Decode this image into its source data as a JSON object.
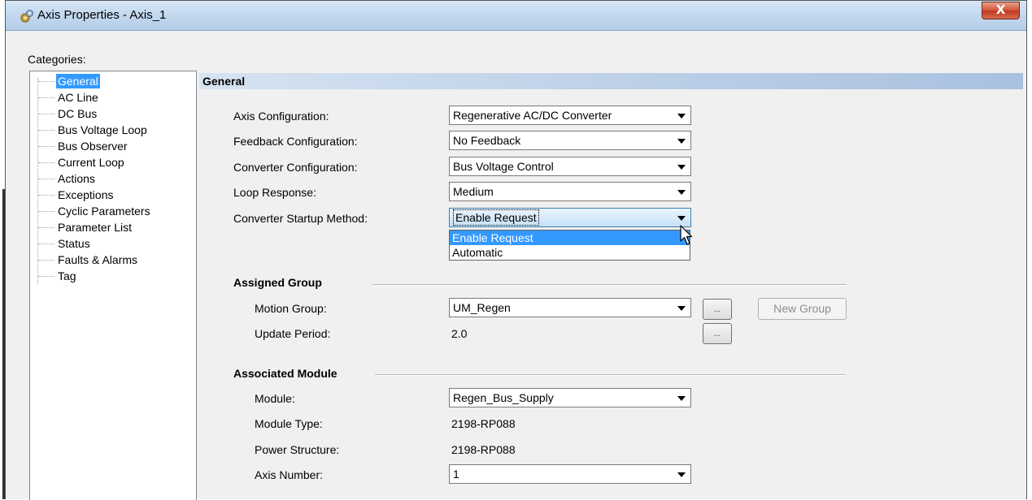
{
  "window": {
    "title": "Axis Properties - Axis_1",
    "close_label": "X"
  },
  "categories": {
    "label": "Categories:",
    "items": [
      "General",
      "AC Line",
      "DC Bus",
      "Bus Voltage Loop",
      "Bus Observer",
      "Current Loop",
      "Actions",
      "Exceptions",
      "Cyclic Parameters",
      "Parameter List",
      "Status",
      "Faults & Alarms",
      "Tag"
    ],
    "selected": "General"
  },
  "general": {
    "header": "General",
    "axis_configuration": {
      "label": "Axis Configuration:",
      "value": "Regenerative AC/DC Converter"
    },
    "feedback_configuration": {
      "label": "Feedback Configuration:",
      "value": "No Feedback"
    },
    "converter_configuration": {
      "label": "Converter Configuration:",
      "value": "Bus Voltage Control"
    },
    "loop_response": {
      "label": "Loop Response:",
      "value": "Medium"
    },
    "converter_startup_method": {
      "label": "Converter Startup Method:",
      "value": "Enable Request",
      "options": [
        "Enable Request",
        "Automatic"
      ],
      "highlighted_option": "Enable Request"
    }
  },
  "assigned_group": {
    "title": "Assigned Group",
    "motion_group": {
      "label": "Motion Group:",
      "value": "UM_Regen",
      "browse_label": "..."
    },
    "update_period": {
      "label": "Update Period:",
      "value": "2.0",
      "browse_label": "..."
    },
    "new_group_label": "New Group"
  },
  "associated_module": {
    "title": "Associated Module",
    "module": {
      "label": "Module:",
      "value": "Regen_Bus_Supply"
    },
    "module_type": {
      "label": "Module Type:",
      "value": "2198-RP088"
    },
    "power_structure": {
      "label": "Power Structure:",
      "value": "2198-RP088"
    },
    "axis_number": {
      "label": "Axis Number:",
      "value": "1"
    }
  },
  "colors": {
    "selection": "#3399ff",
    "title_bar": "#c4d9ef",
    "close_button": "#c0391e"
  },
  "icons": {
    "title": "gear-axis-icon",
    "close": "close-icon",
    "dropdown": "chevron-down-icon",
    "cursor": "mouse-pointer-icon"
  }
}
